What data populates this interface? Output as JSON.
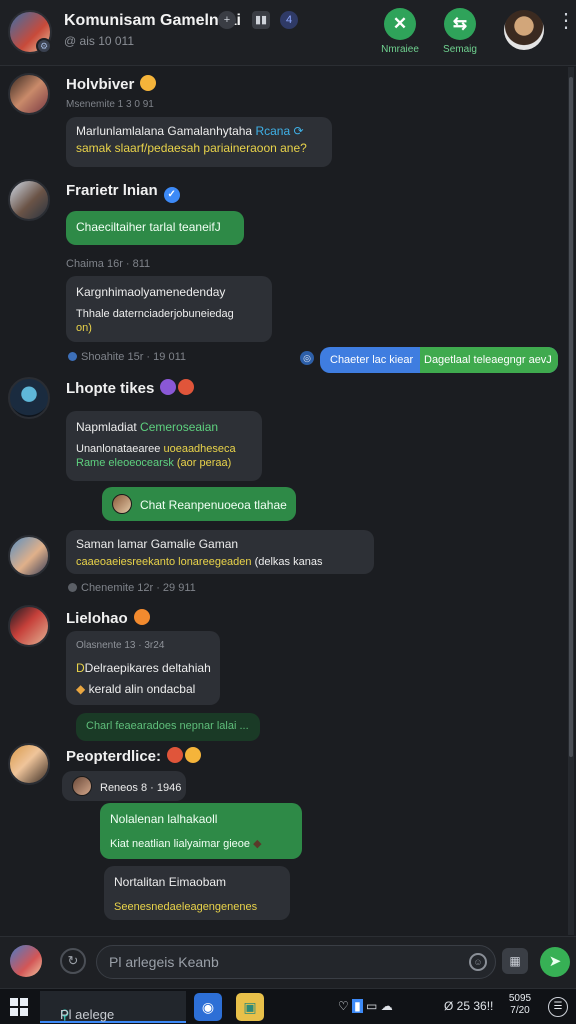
{
  "header": {
    "title": "Komunisam Gamelnsai",
    "subtitle": "@ ais 10 011",
    "title_icon_1": "+",
    "title_icon_3": "4",
    "actions": [
      {
        "label": "Nmraiee",
        "icon": "gamepad-icon"
      },
      {
        "label": "Semaig",
        "icon": "share-icon"
      }
    ],
    "more": "⋮"
  },
  "messages": [
    {
      "author": "Holvbiver",
      "meta": "Msenemite 1 3 0 91",
      "line1": "Marlunlamlalana Gamalanhytaha ",
      "line1_accent": "Rcana",
      "line2": "samak slaarf/pedaesah ",
      "line2_accent": "pariaineraoon ane?"
    },
    {
      "author": "Frarietr lnian",
      "bubble_green": "Chaeciltaiher tarlal teaneifJ"
    },
    {
      "ts": "Chaima 16r · 811",
      "line1": "Kargnhimaolyamenedenday",
      "line2": "Thhale daternciaderjobuneiedag",
      "line3": "on)"
    },
    {
      "ts_left": "Shoahite 15r · 19 011",
      "out_blue": "Chaeter lac kiear",
      "out_green": "Dagetlaal teleaegngr aevJ"
    },
    {
      "author": "Lhopte tikes",
      "line1": "Napmladiat ",
      "line1_accent": "Cemeroseaian",
      "line2": "Unanlonataearee ",
      "line2_accent": "uoeaadheseca",
      "line3": "Rame eleoeocearsk ",
      "line3_accent": "(aor peraa)",
      "sub_green": "Chat Reanpenuoeoa tlahae"
    },
    {
      "line1": "Saman lamar Gamalie Gaman",
      "line2": "caaeoaeiesreekanto lonareegeaden ",
      "line2_tail": "(delkas kanas",
      "ts": "Chenemite 12r · 29 911"
    },
    {
      "author": "Lielohao",
      "meta": "Olasnente 13 · 3r24",
      "line1": "Delraepikares deltahiah",
      "line2": "kerald alin ondacbal",
      "dim_green": "Charl feaearadoes nepnar lalai ..."
    },
    {
      "author": "Peopterdlice:",
      "reply_meta": "Reneos 8 · 1946",
      "green_line1": "Nolalenan lalhakaoll",
      "green_line2": "Kiat neatlian lialyaimar gieoe",
      "dark_line1": "Nortalitan Eimaobam",
      "dark_line2": "Seenesnedaeleagengenenes"
    }
  ],
  "composer": {
    "placeholder": "Pl arlegeis Keanb"
  },
  "taskbar": {
    "search": "Pl aelege",
    "tray_text": "Ø 25 36!!",
    "clock_line1": "5095",
    "clock_line2": "7/20"
  }
}
